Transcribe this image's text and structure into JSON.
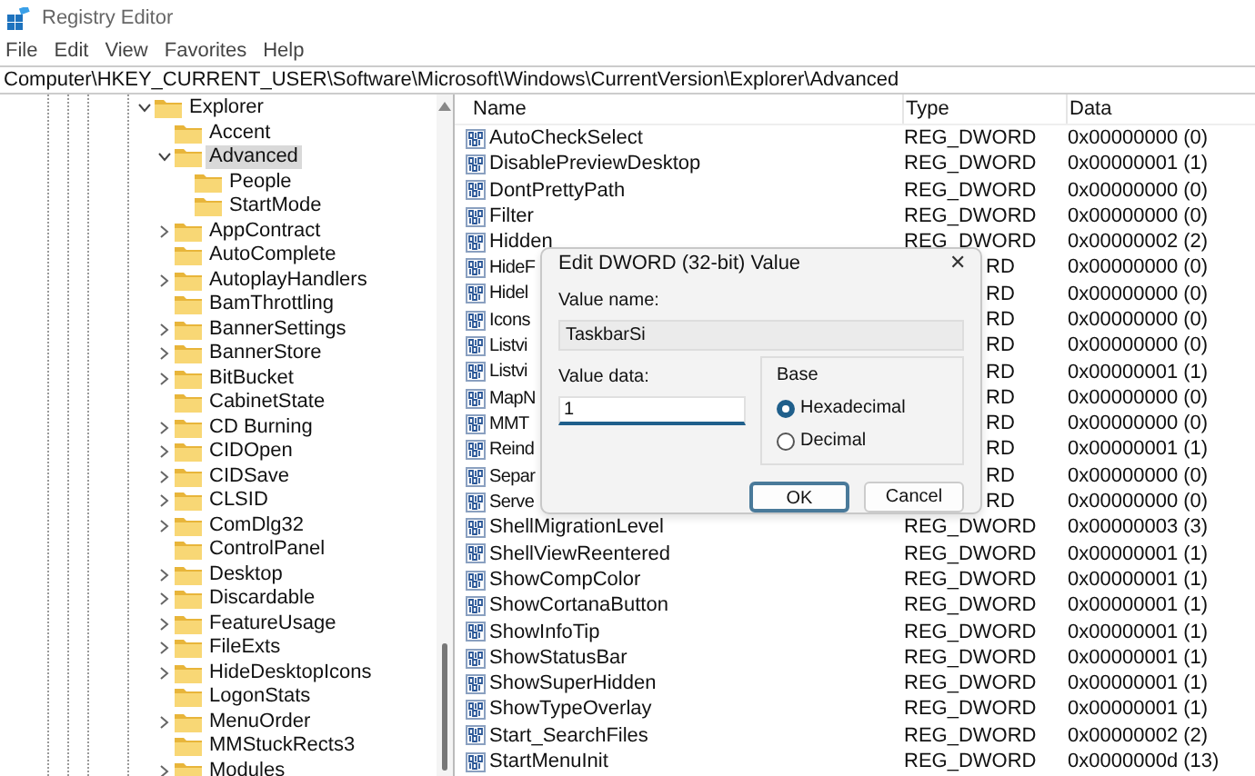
{
  "window": {
    "title": "Registry Editor"
  },
  "menu": [
    "File",
    "Edit",
    "View",
    "Favorites",
    "Help"
  ],
  "address": "Computer\\HKEY_CURRENT_USER\\Software\\Microsoft\\Windows\\CurrentVersion\\Explorer\\Advanced",
  "tree": [
    {
      "label": "Explorer",
      "expanded": true,
      "selected": false,
      "children": [
        {
          "label": "Accent",
          "selected": false
        },
        {
          "label": "Advanced",
          "expanded": true,
          "selected": true,
          "children": [
            {
              "label": "People",
              "selected": false
            },
            {
              "label": "StartMode",
              "selected": false
            }
          ]
        },
        {
          "label": "AppContract",
          "expanded": false,
          "selected": false
        },
        {
          "label": "AutoComplete",
          "selected": false
        },
        {
          "label": "AutoplayHandlers",
          "expanded": false,
          "selected": false
        },
        {
          "label": "BamThrottling",
          "selected": false
        },
        {
          "label": "BannerSettings",
          "expanded": false,
          "selected": false
        },
        {
          "label": "BannerStore",
          "expanded": false,
          "selected": false
        },
        {
          "label": "BitBucket",
          "expanded": false,
          "selected": false
        },
        {
          "label": "CabinetState",
          "selected": false
        },
        {
          "label": "CD Burning",
          "expanded": false,
          "selected": false
        },
        {
          "label": "CIDOpen",
          "expanded": false,
          "selected": false
        },
        {
          "label": "CIDSave",
          "expanded": false,
          "selected": false
        },
        {
          "label": "CLSID",
          "expanded": false,
          "selected": false
        },
        {
          "label": "ComDlg32",
          "expanded": false,
          "selected": false
        },
        {
          "label": "ControlPanel",
          "selected": false
        },
        {
          "label": "Desktop",
          "expanded": false,
          "selected": false
        },
        {
          "label": "Discardable",
          "expanded": false,
          "selected": false
        },
        {
          "label": "FeatureUsage",
          "expanded": false,
          "selected": false
        },
        {
          "label": "FileExts",
          "expanded": false,
          "selected": false
        },
        {
          "label": "HideDesktopIcons",
          "expanded": false,
          "selected": false
        },
        {
          "label": "LogonStats",
          "selected": false
        },
        {
          "label": "MenuOrder",
          "expanded": false,
          "selected": false
        },
        {
          "label": "MMStuckRects3",
          "selected": false
        },
        {
          "label": "Modules",
          "expanded": false,
          "selected": false
        }
      ]
    }
  ],
  "table": {
    "columns": [
      "Name",
      "Type",
      "Data"
    ],
    "rows": [
      {
        "kind": "full",
        "name": "AutoCheckSelect",
        "type": "REG_DWORD",
        "data": "0x00000000 (0)"
      },
      {
        "kind": "full",
        "name": "DisablePreviewDesktop",
        "type": "REG_DWORD",
        "data": "0x00000001 (1)"
      },
      {
        "kind": "full",
        "name": "DontPrettyPath",
        "type": "REG_DWORD",
        "data": "0x00000000 (0)"
      },
      {
        "kind": "full",
        "name": "Filter",
        "type": "REG_DWORD",
        "data": "0x00000000 (0)"
      },
      {
        "kind": "full",
        "name": "Hidden",
        "type": "REG_DWORD",
        "data": "0x00000002 (2)"
      },
      {
        "kind": "covered",
        "name": "HideF",
        "type": "RD",
        "data": "0x00000000 (0)"
      },
      {
        "kind": "covered",
        "name": "Hidel",
        "type": "RD",
        "data": "0x00000000 (0)"
      },
      {
        "kind": "covered",
        "name": "Icons",
        "type": "RD",
        "data": "0x00000000 (0)"
      },
      {
        "kind": "covered",
        "name": "Listvi",
        "type": "RD",
        "data": "0x00000000 (0)"
      },
      {
        "kind": "covered",
        "name": "Listvi",
        "type": "RD",
        "data": "0x00000001 (1)"
      },
      {
        "kind": "covered",
        "name": "MapN",
        "type": "RD",
        "data": "0x00000000 (0)"
      },
      {
        "kind": "covered",
        "name": "MMT",
        "type": "RD",
        "data": "0x00000000 (0)"
      },
      {
        "kind": "covered",
        "name": "Reind",
        "type": "RD",
        "data": "0x00000001 (1)"
      },
      {
        "kind": "covered",
        "name": "Separ",
        "type": "RD",
        "data": "0x00000000 (0)"
      },
      {
        "kind": "covered",
        "name": "Serve",
        "type": "RD",
        "data": "0x00000000 (0)"
      },
      {
        "kind": "full",
        "name": "ShellMigrationLevel",
        "type": "REG_DWORD",
        "data": "0x00000003 (3)"
      },
      {
        "kind": "full",
        "name": "ShellViewReentered",
        "type": "REG_DWORD",
        "data": "0x00000001 (1)"
      },
      {
        "kind": "full",
        "name": "ShowCompColor",
        "type": "REG_DWORD",
        "data": "0x00000001 (1)"
      },
      {
        "kind": "full",
        "name": "ShowCortanaButton",
        "type": "REG_DWORD",
        "data": "0x00000001 (1)"
      },
      {
        "kind": "full",
        "name": "ShowInfoTip",
        "type": "REG_DWORD",
        "data": "0x00000001 (1)"
      },
      {
        "kind": "full",
        "name": "ShowStatusBar",
        "type": "REG_DWORD",
        "data": "0x00000001 (1)"
      },
      {
        "kind": "full",
        "name": "ShowSuperHidden",
        "type": "REG_DWORD",
        "data": "0x00000001 (1)"
      },
      {
        "kind": "full",
        "name": "ShowTypeOverlay",
        "type": "REG_DWORD",
        "data": "0x00000001 (1)"
      },
      {
        "kind": "full",
        "name": "Start_SearchFiles",
        "type": "REG_DWORD",
        "data": "0x00000002 (2)"
      },
      {
        "kind": "full",
        "name": "StartMenuInit",
        "type": "REG_DWORD",
        "data": "0x0000000d (13)"
      }
    ]
  },
  "dialog": {
    "title": "Edit DWORD (32-bit) Value",
    "close": "✕",
    "value_name_label": "Value name:",
    "value_name": "TaskbarSi",
    "value_data_label": "Value data:",
    "value_data": "1",
    "base_label": "Base",
    "bases": [
      {
        "label": "Hexadecimal",
        "selected": true
      },
      {
        "label": "Decimal",
        "selected": false
      }
    ],
    "buttons": [
      {
        "label": "OK",
        "kind": "default"
      },
      {
        "label": "Cancel",
        "kind": "normal"
      }
    ]
  }
}
